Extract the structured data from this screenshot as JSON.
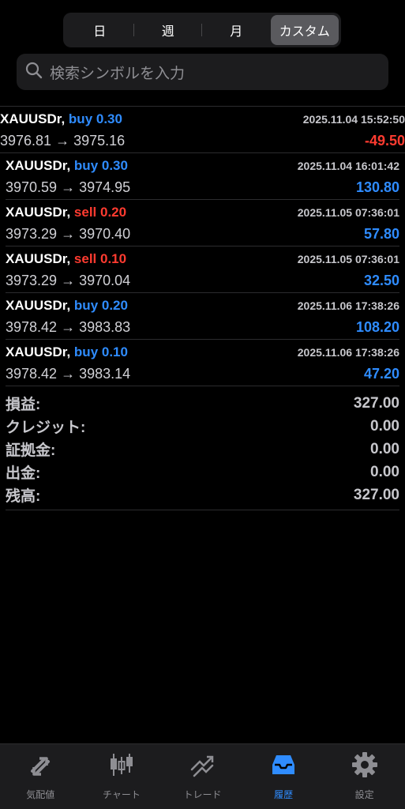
{
  "period_tabs": [
    "日",
    "週",
    "月",
    "カスタム"
  ],
  "search": {
    "placeholder": "検索シンボルを入力"
  },
  "trades": [
    {
      "symbol": "XAUUSDr,",
      "side": "buy",
      "side_text": "buy 0.30",
      "time": "2025.11.04 15:52:50",
      "prices": "3976.81 → 3975.16",
      "profit": "-49.50",
      "profit_sign": "neg"
    },
    {
      "symbol": "XAUUSDr,",
      "side": "buy",
      "side_text": "buy 0.30",
      "time": "2025.11.04 16:01:42",
      "prices": "3970.59 → 3974.95",
      "profit": "130.80",
      "profit_sign": "pos"
    },
    {
      "symbol": "XAUUSDr,",
      "side": "sell",
      "side_text": "sell 0.20",
      "time": "2025.11.05 07:36:01",
      "prices": "3973.29 → 3970.40",
      "profit": "57.80",
      "profit_sign": "pos"
    },
    {
      "symbol": "XAUUSDr,",
      "side": "sell",
      "side_text": "sell 0.10",
      "time": "2025.11.05 07:36:01",
      "prices": "3973.29 → 3970.04",
      "profit": "32.50",
      "profit_sign": "pos"
    },
    {
      "symbol": "XAUUSDr,",
      "side": "buy",
      "side_text": "buy 0.20",
      "time": "2025.11.06 17:38:26",
      "prices": "3978.42 → 3983.83",
      "profit": "108.20",
      "profit_sign": "pos"
    },
    {
      "symbol": "XAUUSDr,",
      "side": "buy",
      "side_text": "buy 0.10",
      "time": "2025.11.06 17:38:26",
      "prices": "3978.42 → 3983.14",
      "profit": "47.20",
      "profit_sign": "pos"
    }
  ],
  "summary": [
    {
      "label": "損益:",
      "value": "327.00"
    },
    {
      "label": "クレジット:",
      "value": "0.00"
    },
    {
      "label": "証拠金:",
      "value": "0.00"
    },
    {
      "label": "出金:",
      "value": "0.00"
    },
    {
      "label": "残高:",
      "value": "327.00"
    }
  ],
  "tabbar": [
    {
      "label": "気配値",
      "icon": "quotes-icon"
    },
    {
      "label": "チャート",
      "icon": "candlestick-icon"
    },
    {
      "label": "トレード",
      "icon": "trade-icon"
    },
    {
      "label": "履歴",
      "icon": "history-inbox-icon",
      "active": true
    },
    {
      "label": "設定",
      "icon": "gear-icon"
    }
  ],
  "colors": {
    "buy": "#2f8cff",
    "sell": "#ff3b30",
    "accent": "#2f8cff"
  }
}
